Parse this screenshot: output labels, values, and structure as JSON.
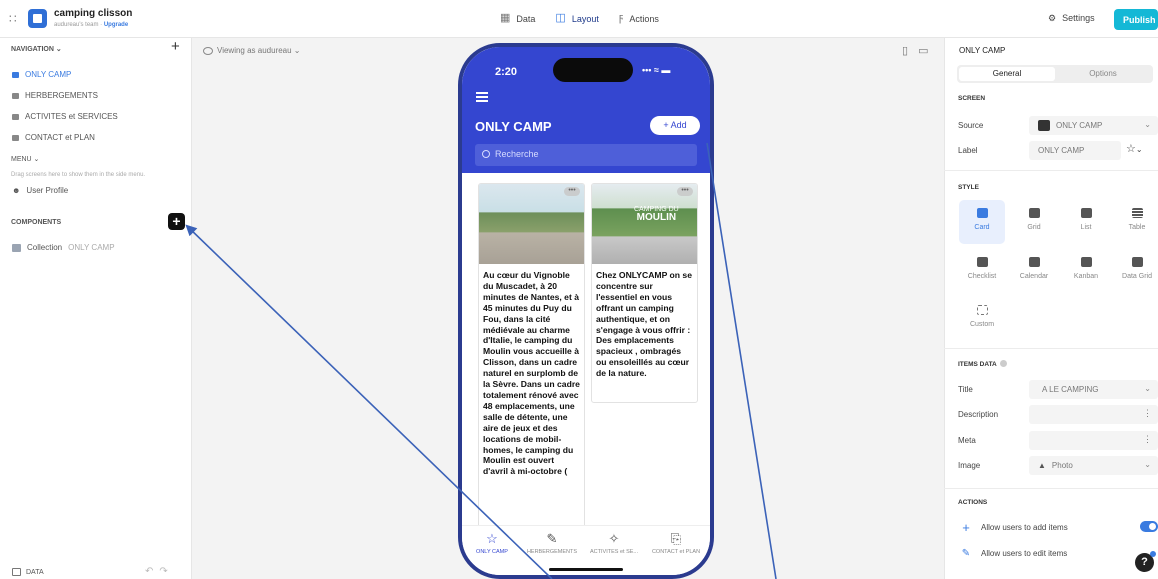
{
  "app": {
    "name": "camping clisson",
    "team": "audureau's team · ",
    "upgrade": "Upgrade"
  },
  "top_tabs": [
    {
      "label": "Data",
      "icon": "table-icon"
    },
    {
      "label": "Layout",
      "icon": "layout-icon",
      "active": true
    },
    {
      "label": "Actions",
      "icon": "lightning-icon"
    }
  ],
  "settings_label": "Settings",
  "publish_label": "Publish",
  "navigation": {
    "header": "NAVIGATION ⌄",
    "items": [
      "ONLY CAMP",
      "HERBERGEMENTS",
      "ACTIVITES et SERVICES",
      "CONTACT et PLAN"
    ],
    "active_index": 0
  },
  "menu": {
    "header": "MENU ⌄",
    "hint": "Drag screens here to show them in the side menu.",
    "user_profile": "User Profile"
  },
  "components": {
    "header": "COMPONENTS",
    "item_prefix": "Collection",
    "item_name": "ONLY CAMP"
  },
  "data_footer": "DATA",
  "viewing_as": "Viewing as audureau ⌄",
  "phone": {
    "time": "2:20",
    "status": "••• ≈ ▬",
    "title": "ONLY CAMP",
    "add_label": "+ Add",
    "search_placeholder": "Recherche",
    "cards": [
      {
        "sign": "",
        "text": "Au cœur du Vignoble du Muscadet, à 20 minutes de Nantes, et à 45 minutes du Puy du Fou, dans la cité médiévale au charme d'Italie, le camping du Moulin vous accueille à Clisson, dans un cadre naturel en surplomb de la Sèvre. Dans un cadre totalement rénové avec 48 emplacements, une salle de détente, une aire de jeux et des locations de mobil-homes, le camping du Moulin est ouvert d'avril à mi-octobre ("
      },
      {
        "sign_small": "CAMPING DU",
        "sign": "MOULIN",
        "text": "Chez ONLYCAMP on se concentre sur l'essentiel en vous offrant un camping authentique, et on s'engage à vous offrir : Des emplacements spacieux , ombragés ou ensoleillés au cœur de la nature."
      }
    ],
    "more_label": "•••",
    "tabs": [
      {
        "label": "ONLY CAMP",
        "icon": "☆"
      },
      {
        "label": "HERBERGEMENTS",
        "icon": "✎"
      },
      {
        "label": "ACTIVITES et SE...",
        "icon": "✧"
      },
      {
        "label": "CONTACT et PLAN",
        "icon": "⎘"
      }
    ]
  },
  "right_panel": {
    "title": "ONLY CAMP",
    "tab_general": "General",
    "tab_options": "Options",
    "screen_header": "SCREEN",
    "source_label": "Source",
    "source_value": "ONLY CAMP",
    "label_label": "Label",
    "label_value": "ONLY CAMP",
    "style_header": "STYLE",
    "styles": [
      "Card",
      "Grid",
      "List",
      "Table",
      "Checklist",
      "Calendar",
      "Kanban",
      "Data Grid",
      "Custom"
    ],
    "active_style": "Card",
    "items_data_header": "ITEMS DATA",
    "title_label": "Title",
    "title_value": "A  LE CAMPING",
    "description_label": "Description",
    "meta_label": "Meta",
    "image_label": "Image",
    "image_value": "Photo",
    "actions_header": "ACTIONS",
    "action_add": "Allow users to add items",
    "action_edit": "Allow users to edit items"
  },
  "help_label": "?",
  "colors": {
    "accent": "#3a7be0",
    "phone_header": "#3446d0",
    "publish": "#14b8d6",
    "arrow": "#3b62b8"
  }
}
